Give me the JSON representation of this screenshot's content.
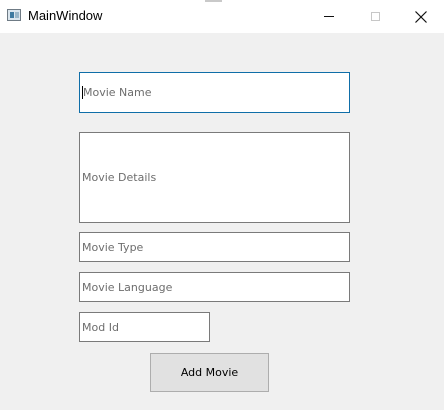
{
  "window": {
    "title": "MainWindow",
    "controls": [
      "minimize-icon",
      "maximize-icon",
      "close-icon"
    ]
  },
  "form": {
    "movie_name": {
      "placeholder": "Movie Name",
      "value": ""
    },
    "movie_details": {
      "placeholder": "Movie Details",
      "value": ""
    },
    "movie_type": {
      "placeholder": "Movie Type",
      "value": ""
    },
    "movie_language": {
      "placeholder": "Movie Language",
      "value": ""
    },
    "mod_id": {
      "placeholder": "Mod Id",
      "value": ""
    },
    "submit_label": "Add Movie"
  },
  "colors": {
    "window_bg": "#f0f0f0",
    "titlebar_bg": "#ffffff",
    "focus_border": "#0f6ea8",
    "field_border": "#7a7a7a",
    "button_bg": "#e1e1e1"
  }
}
